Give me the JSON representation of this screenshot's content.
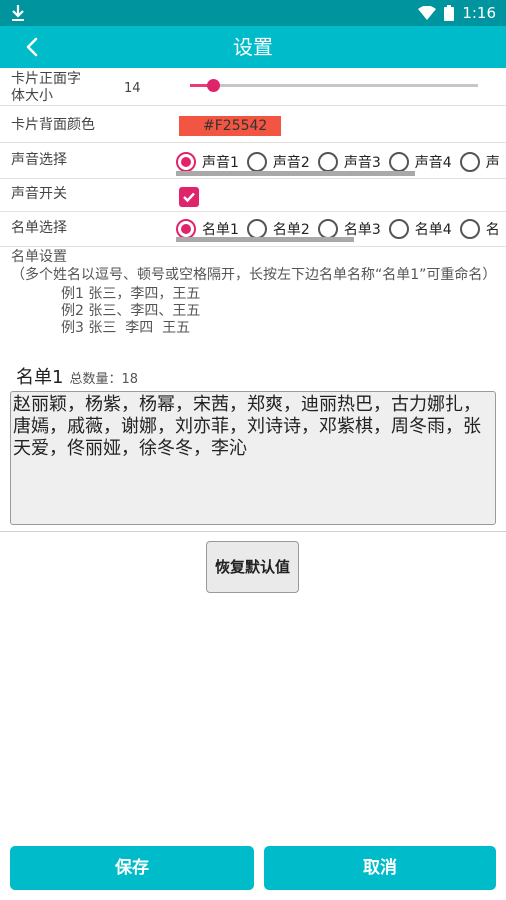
{
  "status_bar": {
    "time": "1:16",
    "icons": [
      "download-icon",
      "wifi-icon",
      "battery-icon"
    ]
  },
  "toolbar": {
    "back_icon": "back-arrow-icon",
    "title": "设置"
  },
  "settings": {
    "font_size": {
      "label": "卡片正面字体大小",
      "label_line1": "卡片正面字",
      "label_line2": "体大小",
      "value": "14",
      "slider_fraction": 0.08
    },
    "back_color": {
      "label": "卡片背面颜色",
      "value": "#F25542"
    },
    "sound_select": {
      "label": "声音选择",
      "options": [
        "声音1",
        "声音2",
        "声音3",
        "声音4",
        "声"
      ],
      "selected": "声音1"
    },
    "sound_switch": {
      "label": "声音开关",
      "checked": true
    },
    "list_select": {
      "label": "名单选择",
      "options": [
        "名单1",
        "名单2",
        "名单3",
        "名单4",
        "名"
      ],
      "selected": "名单1"
    }
  },
  "list_settings": {
    "title": "名单设置",
    "hint": "（多个姓名以逗号、顿号或空格隔开，长按左下边名单名称“名单1”可重命名）",
    "examples": [
      "例1 张三，李四，王五",
      "例2 张三、李四、王五",
      "例3 张三  李四  王五"
    ]
  },
  "current_list": {
    "name": "名单1",
    "count_label": "总数量：",
    "count": "18",
    "content": "赵丽颖，杨紫，杨幂，宋茜，郑爽，迪丽热巴，古力娜扎，唐嫣，戚薇，谢娜，刘亦菲，刘诗诗，邓紫棋，周冬雨，张天爱，佟丽娅，徐冬冬，李沁"
  },
  "buttons": {
    "restore": "恢复默认值",
    "save": "保存",
    "cancel": "取消"
  },
  "colors": {
    "primary": "#00bcca",
    "status_bar": "#00959e",
    "accent": "#e0246b"
  }
}
